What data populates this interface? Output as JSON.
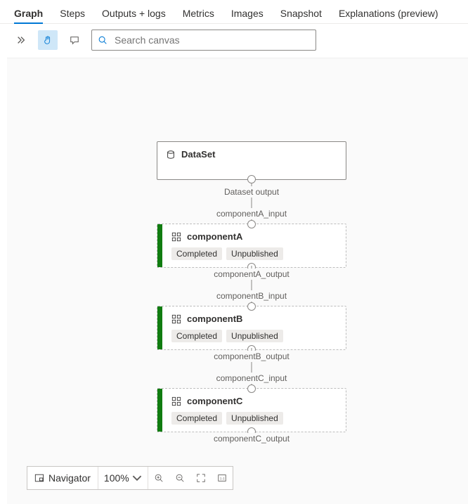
{
  "tabs": [
    {
      "label": "Graph",
      "active": true
    },
    {
      "label": "Steps"
    },
    {
      "label": "Outputs + logs"
    },
    {
      "label": "Metrics"
    },
    {
      "label": "Images"
    },
    {
      "label": "Snapshot"
    },
    {
      "label": "Explanations (preview)"
    }
  ],
  "search": {
    "placeholder": "Search canvas"
  },
  "nodes": {
    "dataset": {
      "title": "DataSet"
    },
    "a": {
      "title": "componentA",
      "input_label": "componentA_input",
      "output_label": "componentA_output",
      "tag1": "Completed",
      "tag2": "Unpublished"
    },
    "b": {
      "title": "componentB",
      "input_label": "componentB_input",
      "output_label": "componentB_output",
      "tag1": "Completed",
      "tag2": "Unpublished"
    },
    "c": {
      "title": "componentC",
      "input_label": "componentC_input",
      "output_label": "componentC_output",
      "tag1": "Completed",
      "tag2": "Unpublished"
    },
    "dataset_output_label": "Dataset output"
  },
  "navigator": {
    "label": "Navigator",
    "zoom": "100%"
  }
}
